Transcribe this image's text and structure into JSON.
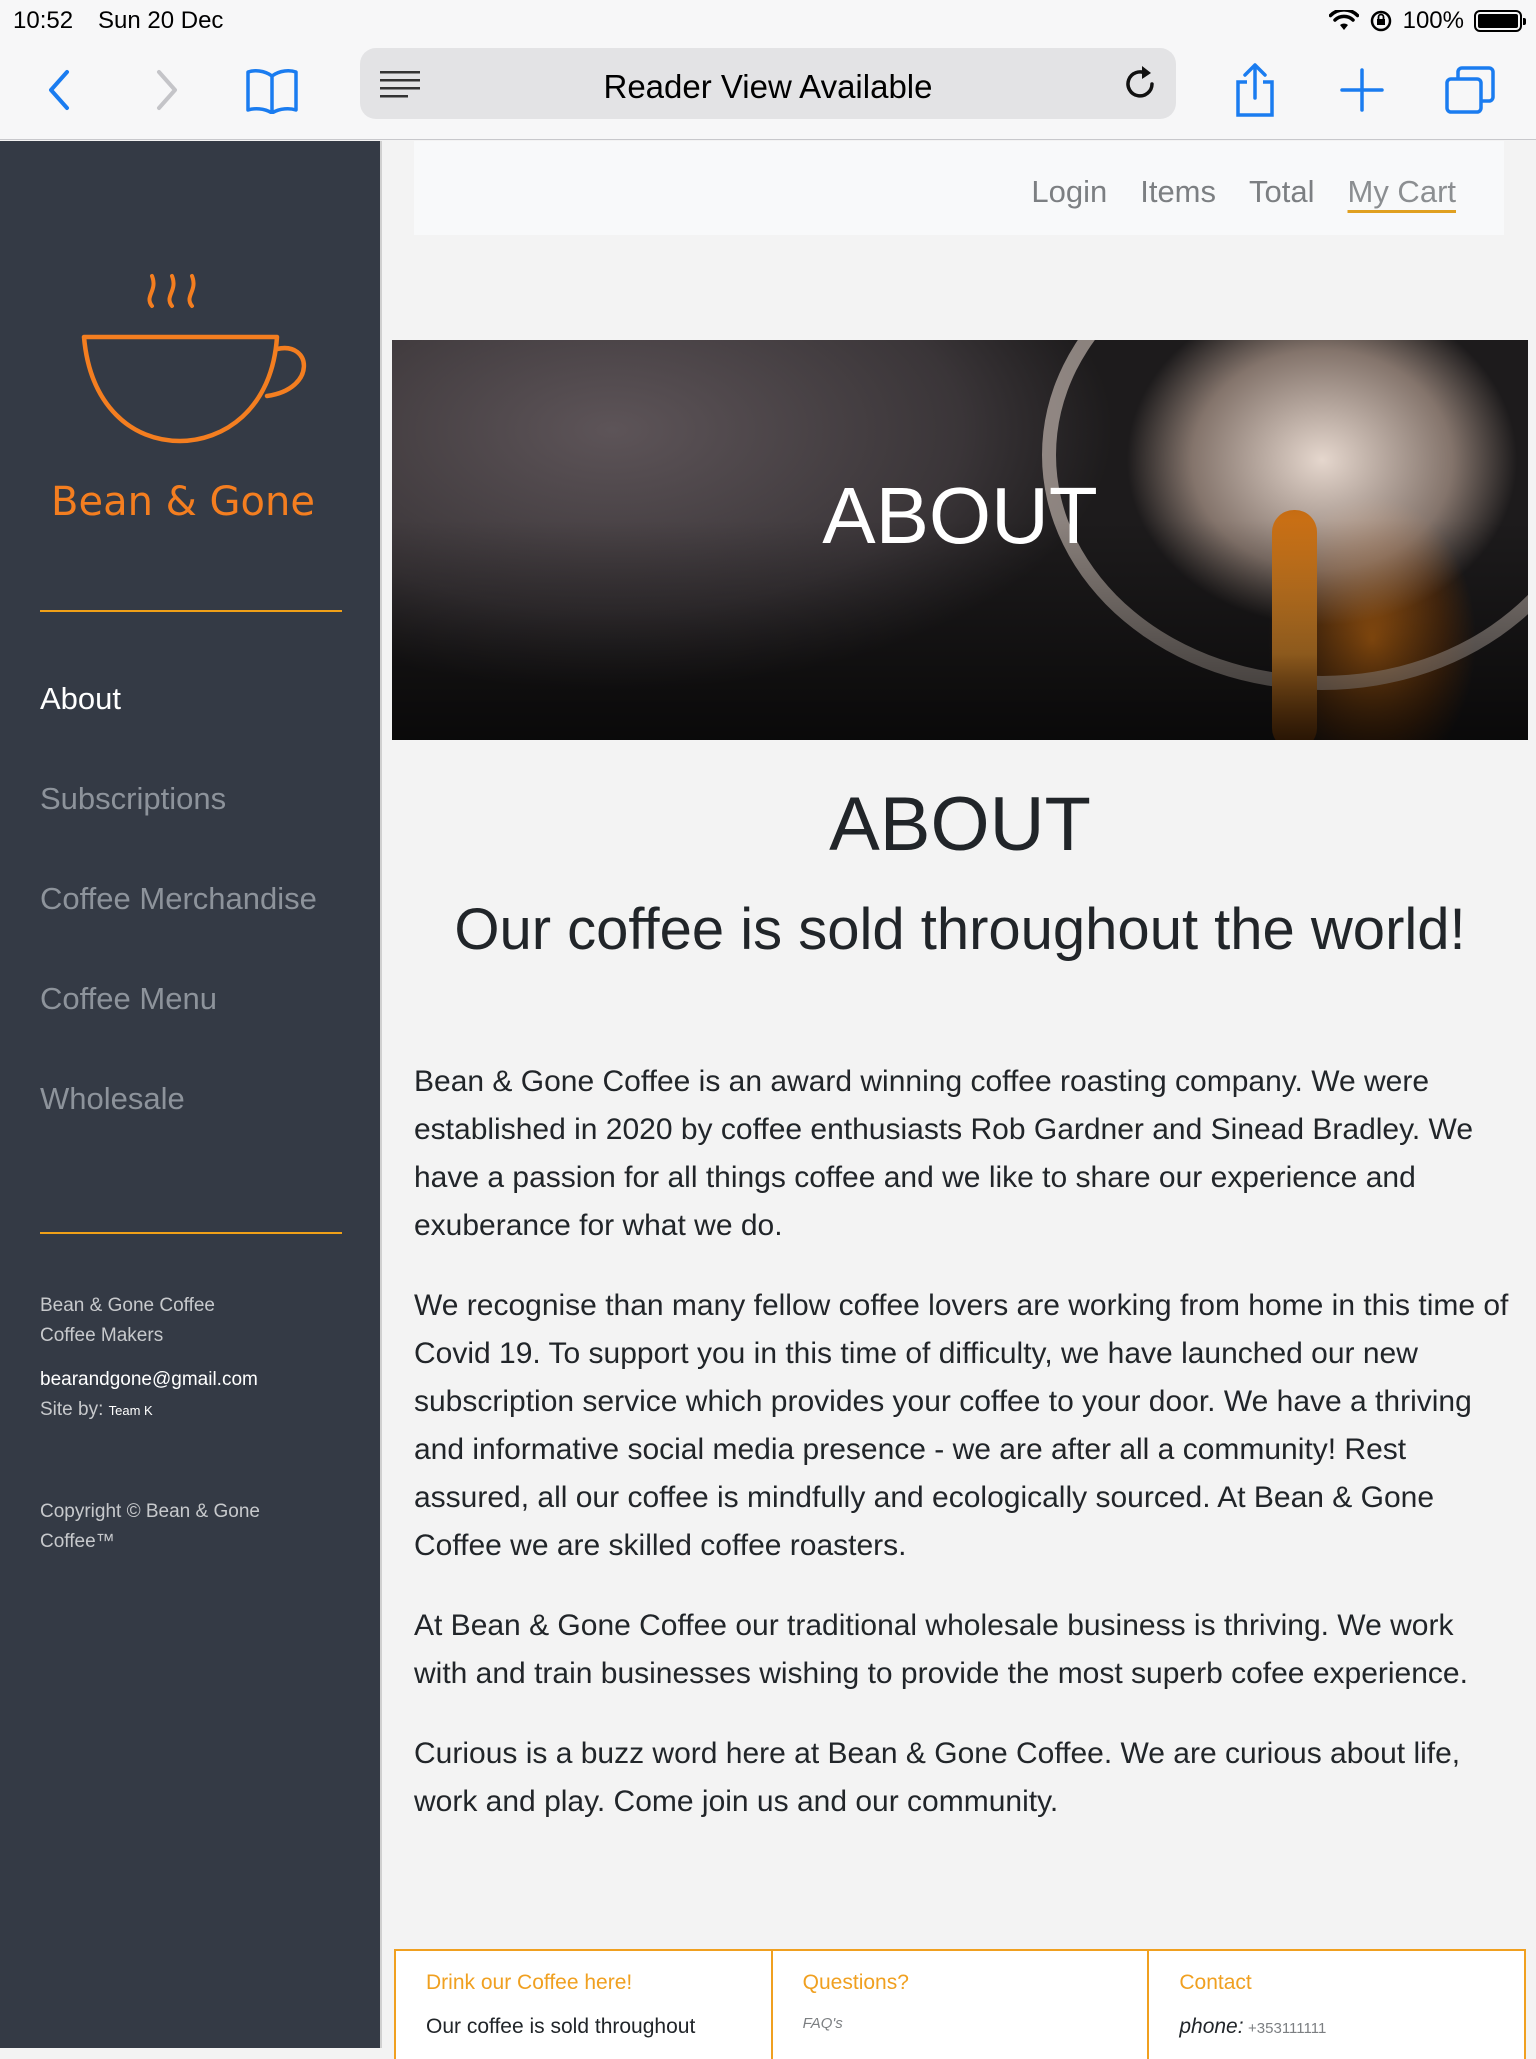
{
  "status_bar": {
    "time": "10:52",
    "date": "Sun 20 Dec",
    "battery": "100%",
    "battery_level": 1.0
  },
  "browser": {
    "address_text": "Reader View Available"
  },
  "sidebar": {
    "brand": "Bean & Gone",
    "nav": [
      {
        "label": "About",
        "active": true
      },
      {
        "label": "Subscriptions",
        "active": false
      },
      {
        "label": "Coffee Merchandise",
        "active": false
      },
      {
        "label": "Coffee Menu",
        "active": false
      },
      {
        "label": "Wholesale",
        "active": false
      }
    ],
    "info_line1": "Bean & Gone Coffee",
    "info_line2": "Coffee Makers",
    "email": "bearandgone@gmail.com",
    "site_by_label": "Site by:",
    "site_by": "Team K",
    "copyright": "Copyright © Bean & Gone Coffee™"
  },
  "topnav": {
    "login": "Login",
    "items": "Items",
    "total": "Total",
    "cart": "My Cart"
  },
  "hero": {
    "title": "ABOUT"
  },
  "content": {
    "heading": "ABOUT",
    "subheading": "Our coffee is sold throughout the world!",
    "paragraphs": [
      "Bean & Gone Coffee is an award winning coffee roasting company. We were established in 2020 by coffee enthusiasts Rob Gardner and Sinead Bradley. We have a passion for all things coffee and we like to share our experience and exuberance for what we do.",
      "We recognise than many fellow coffee lovers are working from home in this time of Covid 19. To support you in this time of difficulty, we have launched our new subscription service which provides your coffee to your door. We have a thriving and informative social media presence - we are after all a community! Rest assured, all our coffee is mindfully and ecologically sourced. At Bean & Gone Coffee we are skilled coffee roasters.",
      "At Bean & Gone Coffee our traditional wholesale business is thriving. We work with and train businesses wishing to provide the most superb cofee experience.",
      "Curious is a buzz word here at Bean & Gone Coffee. We are curious about life, work and play. Come join us and our community."
    ]
  },
  "footer": {
    "col1_head": "Drink our Coffee here!",
    "col1_text": "Our coffee is sold throughout",
    "col2_head": "Questions?",
    "col2_text": "FAQ's",
    "col3_head": "Contact",
    "col3_phone_label": "phone:",
    "col3_phone": "+353111111"
  },
  "colors": {
    "accent": "#f47e20",
    "divider": "#f0a018",
    "sidebar_bg": "#343a45",
    "ios_blue": "#1a7cf0"
  }
}
